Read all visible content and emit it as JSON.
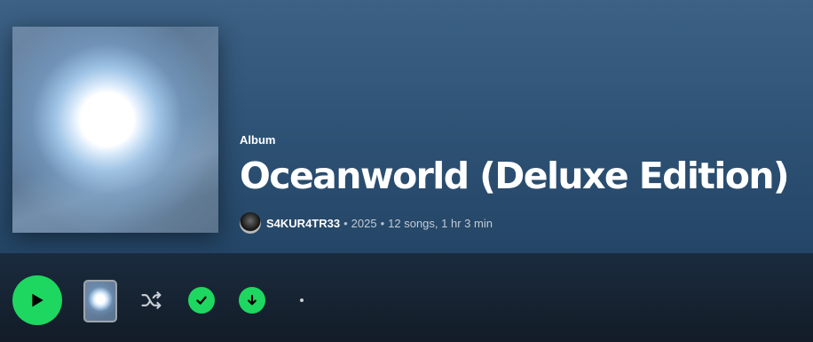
{
  "album": {
    "type_label": "Album",
    "title": "Oceanworld (Deluxe Edition)",
    "artist": "S4KUR4TR33",
    "year": "2025",
    "song_count": "12 songs",
    "duration": "1 hr 3 min",
    "separator": "•"
  },
  "actions": {
    "play_icon": "play-icon",
    "shuffle_icon": "shuffle-icon",
    "saved_icon": "check-icon",
    "download_icon": "download-icon",
    "more_icon": "more-options-icon"
  },
  "colors": {
    "accent": "#1ed760",
    "hero_top": "#3c6185",
    "hero_bottom": "#244566",
    "background": "#121a24"
  }
}
